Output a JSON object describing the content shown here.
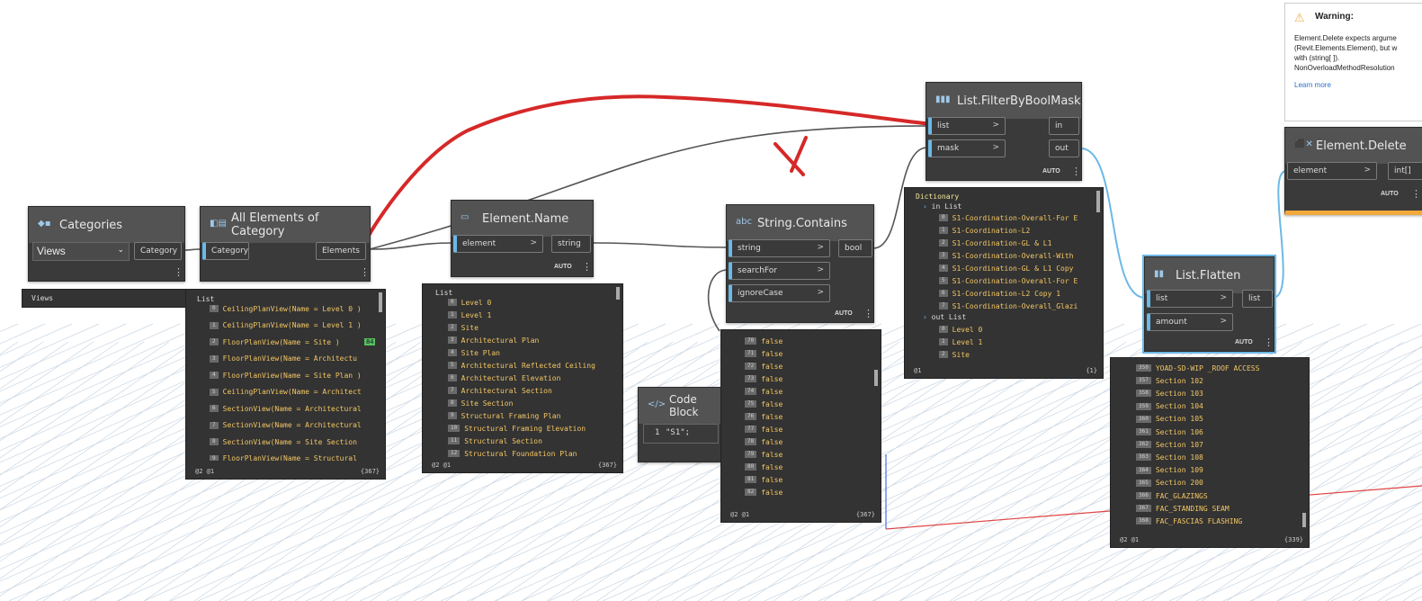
{
  "nodes": {
    "categories": {
      "title": "Categories",
      "value": "Views",
      "output": "Category"
    },
    "all_elements": {
      "title": "All Elements of Category",
      "input": "Category",
      "output": "Elements"
    },
    "element_name": {
      "title": "Element.Name",
      "input": "element",
      "output": "string",
      "lacing": "AUTO"
    },
    "string_contains": {
      "title": "String.Contains",
      "inputs": [
        "string",
        "searchFor",
        "ignoreCase"
      ],
      "output": "bool",
      "lacing": "AUTO"
    },
    "filter": {
      "title": "List.FilterByBoolMask",
      "inputs": [
        "list",
        "mask"
      ],
      "outputs": [
        "in",
        "out"
      ],
      "lacing": "AUTO"
    },
    "flatten": {
      "title": "List.Flatten",
      "inputs": [
        "list",
        "amount"
      ],
      "output": "list",
      "lacing": "AUTO"
    },
    "delete": {
      "title": "Element.Delete",
      "input": "element",
      "output": "int[]",
      "lacing": "AUTO"
    },
    "code_block": {
      "title": "Code Block",
      "line_no": "1",
      "code": "\"S1\";"
    }
  },
  "previews": {
    "categories": {
      "text": "Views"
    },
    "all_elements": {
      "header": "List",
      "items": [
        {
          "i": "0",
          "v": "CeilingPlanView(Name = Level 0 )"
        },
        {
          "i": "1",
          "v": "CeilingPlanView(Name = Level 1 )"
        },
        {
          "i": "2",
          "v": "FloorPlanView(Name = Site )"
        },
        {
          "i": "3",
          "v": "FloorPlanView(Name = Architectu"
        },
        {
          "i": "4",
          "v": "FloorPlanView(Name = Site Plan )"
        },
        {
          "i": "5",
          "v": "CeilingPlanView(Name = Architect"
        },
        {
          "i": "6",
          "v": "SectionView(Name = Architectural"
        },
        {
          "i": "7",
          "v": "SectionView(Name = Architectural"
        },
        {
          "i": "8",
          "v": "SectionView(Name = Site Section"
        },
        {
          "i": "9",
          "v": "FloorPlanView(Name = Structural"
        }
      ],
      "badge": "84",
      "footer": "@2 @1",
      "count": "{367}"
    },
    "element_name": {
      "header": "List",
      "items": [
        {
          "i": "0",
          "v": "Level 0"
        },
        {
          "i": "1",
          "v": "Level 1"
        },
        {
          "i": "2",
          "v": "Site"
        },
        {
          "i": "3",
          "v": "Architectural Plan"
        },
        {
          "i": "4",
          "v": "Site Plan"
        },
        {
          "i": "5",
          "v": "Architectural Reflected Ceiling"
        },
        {
          "i": "6",
          "v": "Architectural Elevation"
        },
        {
          "i": "7",
          "v": "Architectural Section"
        },
        {
          "i": "8",
          "v": "Site Section"
        },
        {
          "i": "9",
          "v": "Structural Framing Plan"
        },
        {
          "i": "10",
          "v": "Structural Framing Elevation"
        },
        {
          "i": "11",
          "v": "Structural Section"
        },
        {
          "i": "12",
          "v": "Structural Foundation Plan"
        }
      ],
      "footer": "@2 @1",
      "count": "{367}"
    },
    "string_contains": {
      "items": [
        {
          "i": "70",
          "v": "false"
        },
        {
          "i": "71",
          "v": "false"
        },
        {
          "i": "72",
          "v": "false"
        },
        {
          "i": "73",
          "v": "false"
        },
        {
          "i": "74",
          "v": "false"
        },
        {
          "i": "75",
          "v": "false"
        },
        {
          "i": "76",
          "v": "false"
        },
        {
          "i": "77",
          "v": "false"
        },
        {
          "i": "78",
          "v": "false"
        },
        {
          "i": "79",
          "v": "false"
        },
        {
          "i": "80",
          "v": "false"
        },
        {
          "i": "81",
          "v": "false"
        },
        {
          "i": "82",
          "v": "false"
        }
      ],
      "footer": "@2 @1",
      "count": "{367}"
    },
    "filter": {
      "header": "Dictionary",
      "in_label": "in List",
      "in_items": [
        {
          "i": "0",
          "v": "S1-Coordination-Overall-For E"
        },
        {
          "i": "1",
          "v": "S1-Coordination-L2"
        },
        {
          "i": "2",
          "v": "S1-Coordination-GL & L1"
        },
        {
          "i": "3",
          "v": "S1-Coordination-Overall-With"
        },
        {
          "i": "4",
          "v": "S1-Coordination-GL & L1 Copy"
        },
        {
          "i": "5",
          "v": "S1-Coordination-Overall-For E"
        },
        {
          "i": "6",
          "v": "S1-Coordination-L2 Copy 1"
        },
        {
          "i": "7",
          "v": "S1-Coordination-Overall_Glazi"
        }
      ],
      "out_label": "out List",
      "out_items": [
        {
          "i": "0",
          "v": "Level 0"
        },
        {
          "i": "1",
          "v": "Level 1"
        },
        {
          "i": "2",
          "v": "Site"
        }
      ],
      "footer": "@1",
      "count": "{1}"
    },
    "flatten": {
      "items": [
        {
          "i": "350",
          "v": "YOAD-SD-WIP _ROOF ACCESS"
        },
        {
          "i": "357",
          "v": "Section 102"
        },
        {
          "i": "358",
          "v": "Section 103"
        },
        {
          "i": "359",
          "v": "Section 104"
        },
        {
          "i": "360",
          "v": "Section 105"
        },
        {
          "i": "361",
          "v": "Section 106"
        },
        {
          "i": "362",
          "v": "Section 107"
        },
        {
          "i": "363",
          "v": "Section 108"
        },
        {
          "i": "364",
          "v": "Section 109"
        },
        {
          "i": "365",
          "v": "Section 200"
        },
        {
          "i": "366",
          "v": "FAC_GLAZINGS"
        },
        {
          "i": "367",
          "v": "FAC_STANDING SEAM"
        },
        {
          "i": "368",
          "v": "FAC_FASCIAS FLASHING"
        }
      ],
      "footer": "@2 @1",
      "count": "{339}"
    }
  },
  "warning": {
    "title": "Warning:",
    "lines": [
      "Element.Delete expects argume",
      "(Revit.Elements.Element), but w",
      "with (string[ ]).",
      "NonOverloadMethodResolution"
    ],
    "link": "Learn more"
  },
  "colors": {
    "wire": "#555555",
    "wire_selected": "#6cb8e6",
    "annotation": "#d62828",
    "grid": "#c9d6e3",
    "axis_red": "#e04444",
    "axis_blue": "#4a6cf0",
    "warning_icon": "#f2a93b",
    "port_accent": "#6cb8e6"
  }
}
